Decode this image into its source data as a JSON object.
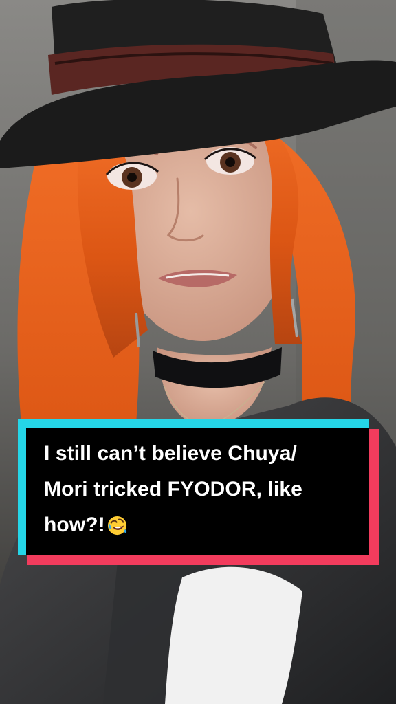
{
  "caption": {
    "line1": "I still can’t believe Chuya/",
    "line2": "Mori tricked FYODOR, like",
    "line3": "how?!",
    "emoji": "rolling-on-the-floor-laughing-icon"
  },
  "colors": {
    "background": "#6f6e6c",
    "hair": "#e55a17",
    "hat": "#1f1f1f",
    "hat_band": "#5a2622",
    "skin": "#d8aa96",
    "caption_box": "#000000",
    "caption_text": "#ffffff",
    "accent_cyan": "#25d6e8",
    "accent_red": "#f23c5d"
  }
}
